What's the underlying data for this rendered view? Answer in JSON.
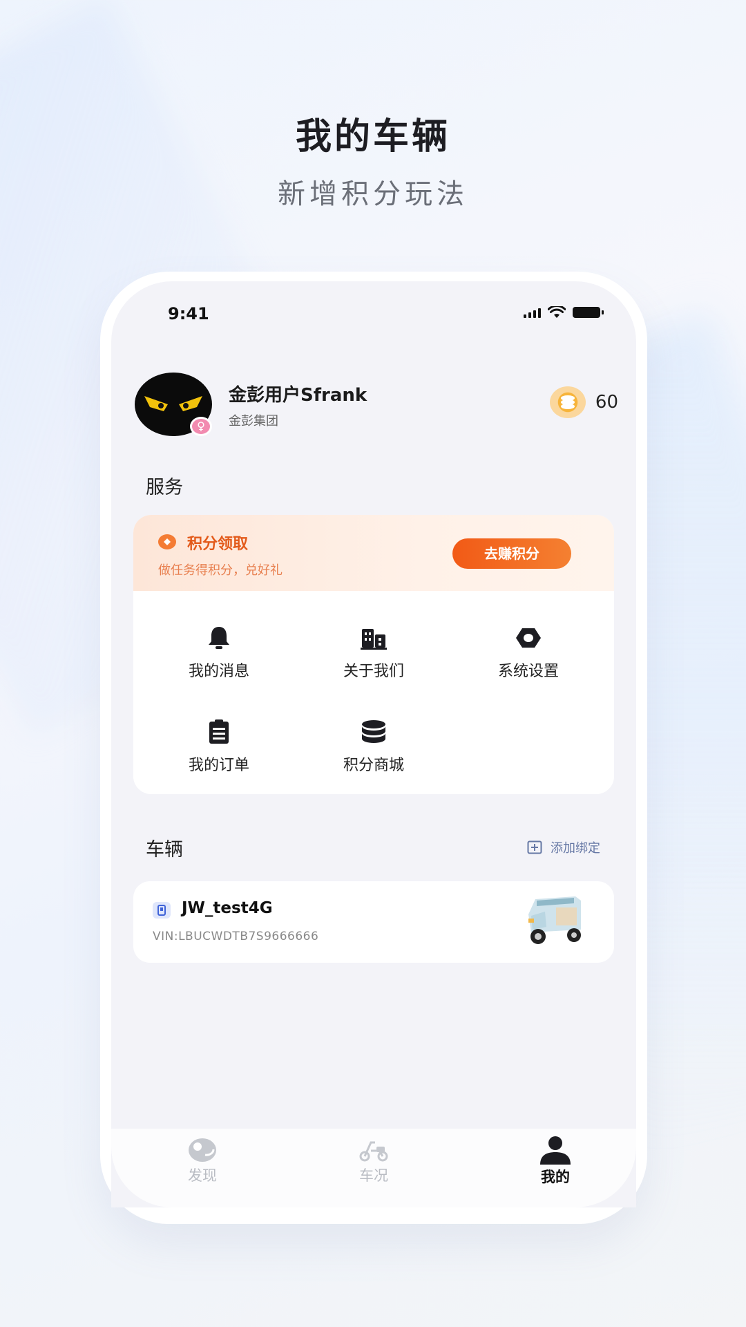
{
  "promo": {
    "title": "我的车辆",
    "subtitle": "新增积分玩法"
  },
  "status_bar": {
    "time": "9:41",
    "icons": [
      "signal-icon",
      "wifi-icon",
      "battery-icon"
    ]
  },
  "profile": {
    "name": "金彭用户Sfrank",
    "organization": "金彭集团",
    "points": "60",
    "badge_icon": "female-icon"
  },
  "services": {
    "section_title": "服务",
    "banner": {
      "title": "积分领取",
      "description": "做任务得积分，兑好礼",
      "button_label": "去赚积分"
    },
    "items": [
      {
        "label": "我的消息",
        "icon": "bell-icon"
      },
      {
        "label": "关于我们",
        "icon": "building-icon"
      },
      {
        "label": "系统设置",
        "icon": "gear-icon"
      },
      {
        "label": "我的订单",
        "icon": "clipboard-icon"
      },
      {
        "label": "积分商城",
        "icon": "coins-icon"
      }
    ]
  },
  "vehicles": {
    "section_title": "车辆",
    "add_label": "添加绑定",
    "items": [
      {
        "name": "JW_test4G",
        "vin": "VIN:LBUCWDTB7S9666666"
      }
    ]
  },
  "tabbar": {
    "tabs": [
      {
        "label": "发现",
        "icon": "discover-icon",
        "active": false
      },
      {
        "label": "车况",
        "icon": "scooter-icon",
        "active": false
      },
      {
        "label": "我的",
        "icon": "person-icon",
        "active": true
      }
    ]
  },
  "colors": {
    "accent": "#f25a16",
    "banner_title": "#e35a1a",
    "tab_inactive": "#b9bcc3",
    "tab_active": "#111111"
  }
}
